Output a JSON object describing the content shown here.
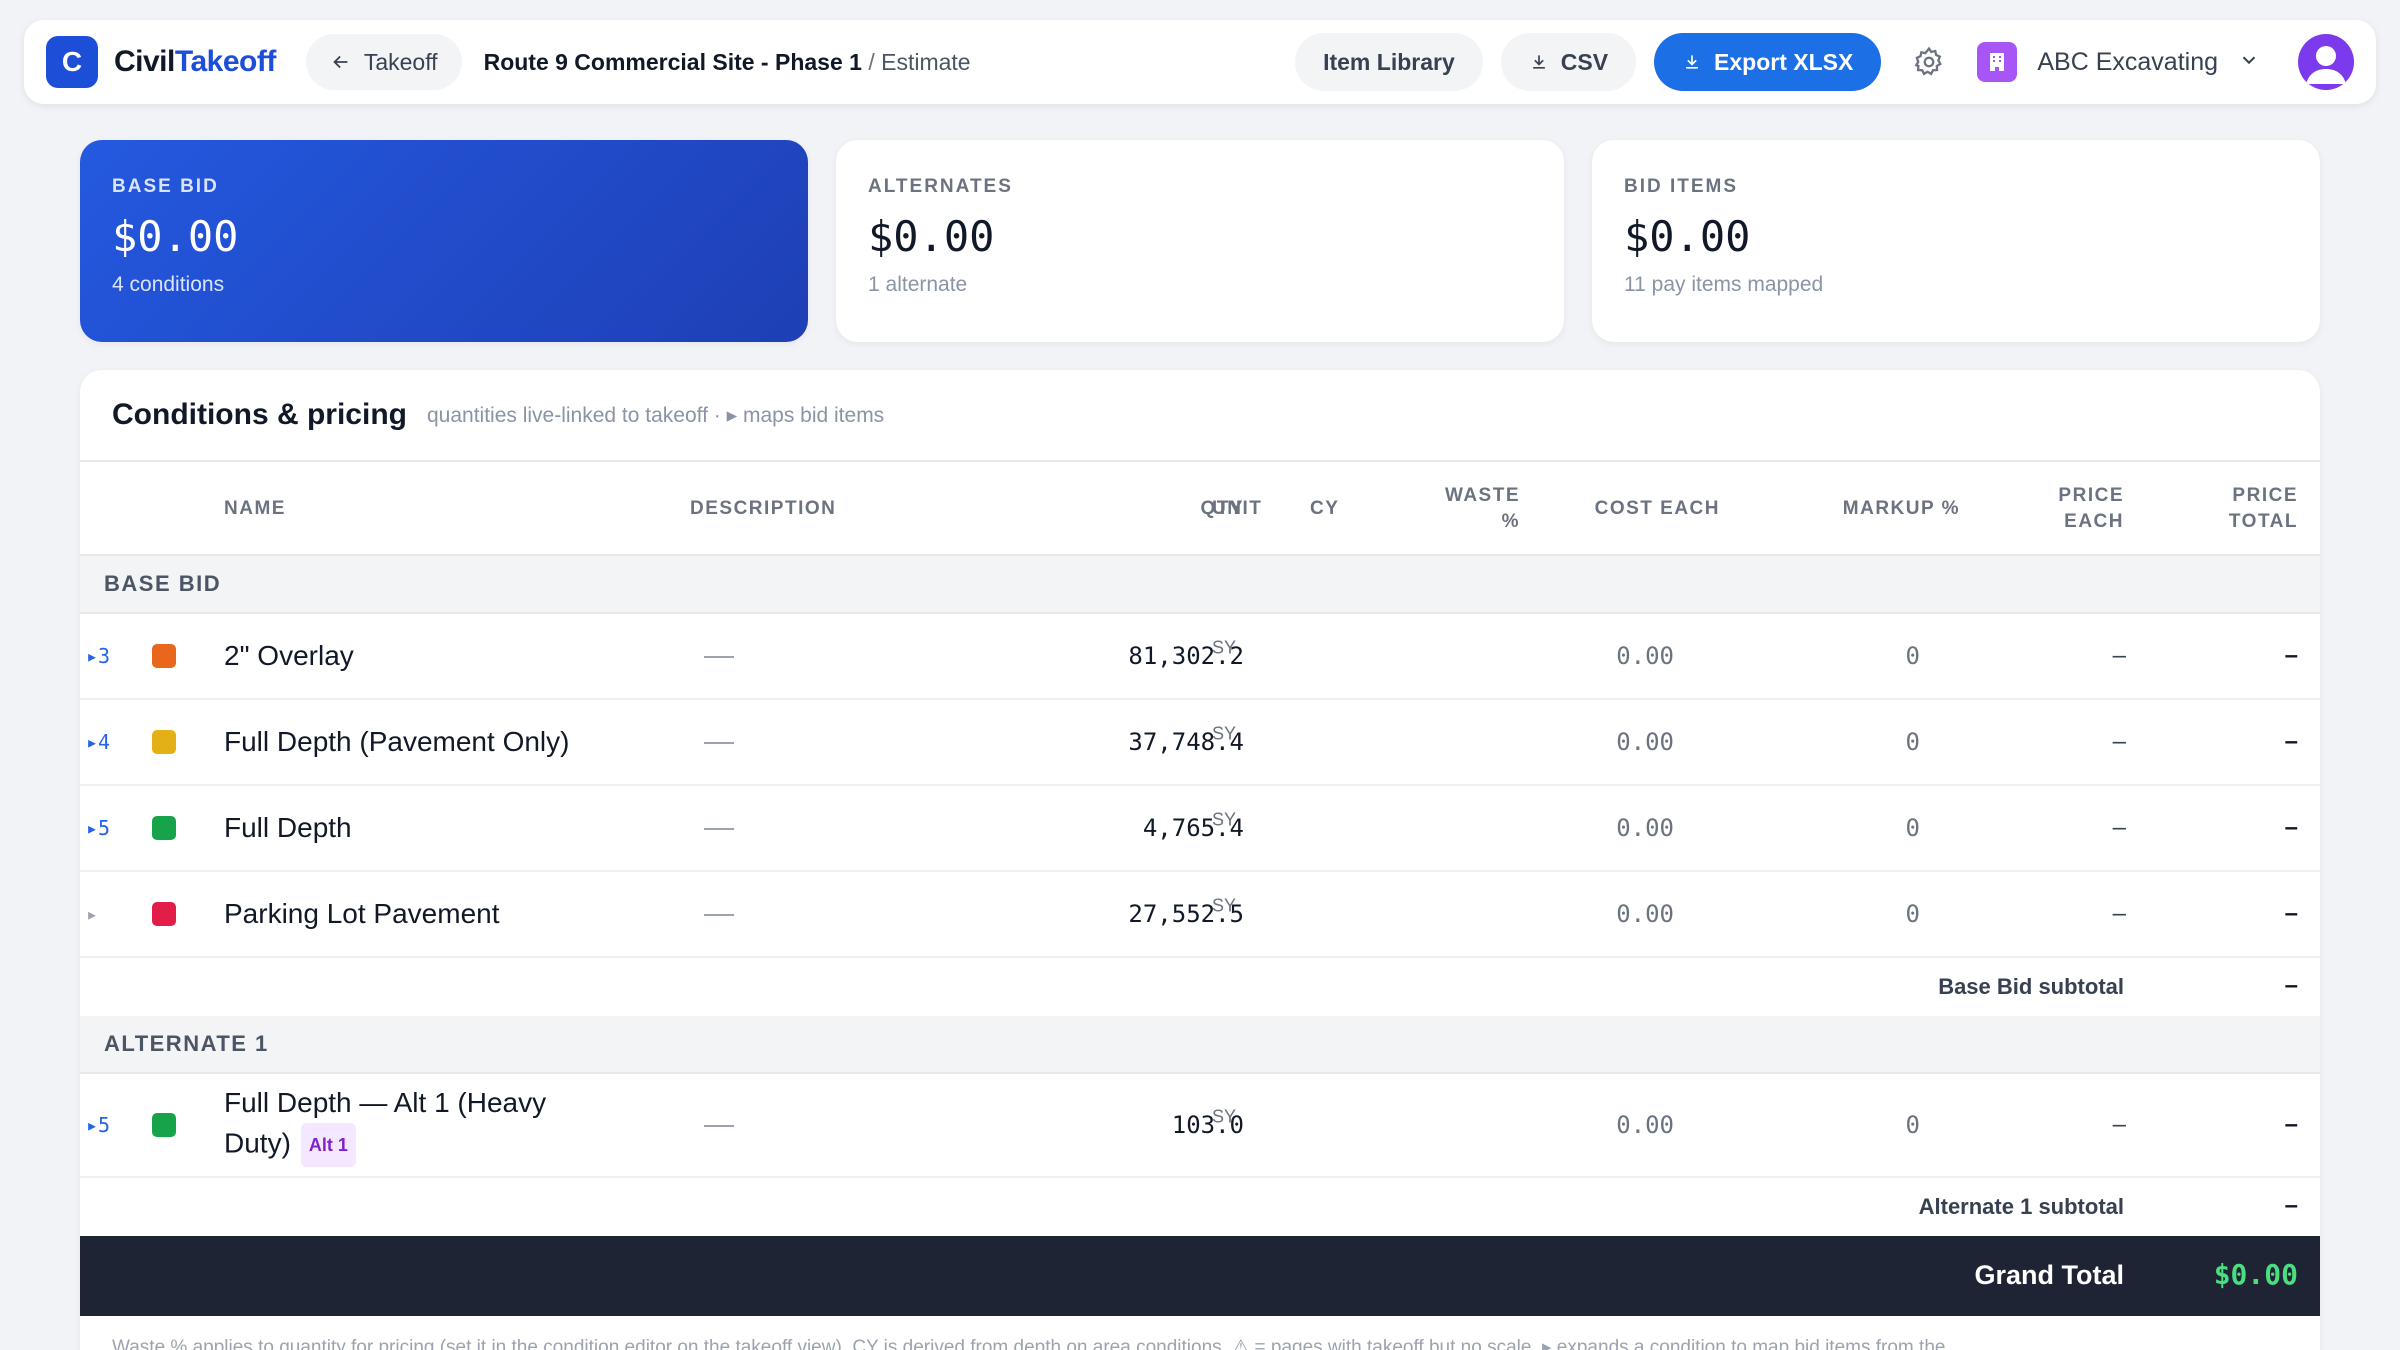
{
  "app": {
    "logo_letter": "C",
    "brand_part1": "Civil",
    "brand_part2": "Takeoff"
  },
  "nav": {
    "back_label": "Takeoff",
    "project": "Route 9 Commercial Site - Phase 1",
    "separator": "/",
    "page": "Estimate"
  },
  "toolbar": {
    "item_library_label": "Item Library",
    "csv_label": "CSV",
    "export_label": "Export XLSX",
    "company_name": "ABC Excavating"
  },
  "cards": [
    {
      "label": "BASE BID",
      "value": "$0.00",
      "sub": "4 conditions"
    },
    {
      "label": "ALTERNATES",
      "value": "$0.00",
      "sub": "1 alternate"
    },
    {
      "label": "BID ITEMS",
      "value": "$0.00",
      "sub": "11 pay items mapped"
    }
  ],
  "panel": {
    "title": "Conditions & pricing",
    "subtitle": "quantities live-linked to takeoff · ▸ maps bid items"
  },
  "columns": {
    "name": "NAME",
    "description": "DESCRIPTION",
    "qty": "QTY",
    "unit": "UNIT",
    "cy": "CY",
    "waste_1": "WASTE",
    "waste_2": "%",
    "cost_each": "COST EACH",
    "markup": "MARKUP %",
    "price_each_1": "PRICE",
    "price_each_2": "EACH",
    "price_total_1": "PRICE",
    "price_total_2": "TOTAL"
  },
  "sections": {
    "base_bid": {
      "label": "BASE BID",
      "rows": [
        {
          "expand": "▸3",
          "color": "#e8671c",
          "name": "2\" Overlay",
          "desc": "—",
          "qty": "81,302.2",
          "unit": "SY",
          "cost": "0.00",
          "markup": "0",
          "price_each": "–",
          "price_total": "–"
        },
        {
          "expand": "▸4",
          "color": "#e3b015",
          "name": "Full Depth (Pavement Only)",
          "desc": "—",
          "qty": "37,748.4",
          "unit": "SY",
          "cost": "0.00",
          "markup": "0",
          "price_each": "–",
          "price_total": "–"
        },
        {
          "expand": "▸5",
          "color": "#16a34a",
          "name": "Full Depth",
          "desc": "—",
          "qty": "4,765.4",
          "unit": "SY",
          "cost": "0.00",
          "markup": "0",
          "price_each": "–",
          "price_total": "–"
        },
        {
          "expand": "▸",
          "color": "#e11d48",
          "name": "Parking Lot Pavement",
          "desc": "—",
          "qty": "27,552.5",
          "unit": "SY",
          "cost": "0.00",
          "markup": "0",
          "price_each": "–",
          "price_total": "–"
        }
      ],
      "subtotal_label": "Base Bid subtotal",
      "subtotal_value": "–"
    },
    "alternate_1": {
      "label": "ALTERNATE 1",
      "rows": [
        {
          "expand": "▸5",
          "color": "#16a34a",
          "name": "Full Depth — Alt 1 (Heavy Duty)",
          "badge": "Alt 1",
          "desc": "—",
          "qty": "103.0",
          "unit": "SY",
          "cost": "0.00",
          "markup": "0",
          "price_each": "–",
          "price_total": "–"
        }
      ],
      "subtotal_label": "Alternate 1 subtotal",
      "subtotal_value": "–"
    }
  },
  "grand_total": {
    "label": "Grand Total",
    "value": "$0.00"
  },
  "footnote": "Waste % applies to quantity for pricing (set it in the condition editor on the takeoff view). CY is derived from depth on area conditions. ⚠ = pages with takeoff but no scale. ▸ expands a condition to map bid items from the"
}
